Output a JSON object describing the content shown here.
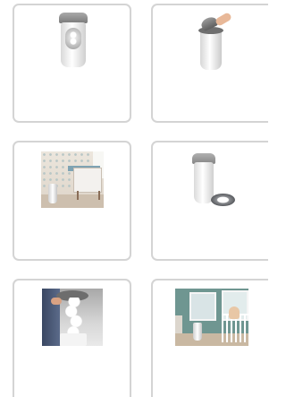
{
  "gallery": {
    "items": [
      {
        "icon": "nappy-bin-front-image"
      },
      {
        "icon": "nappy-bin-lid-open-image"
      },
      {
        "icon": "nursery-changing-table-image"
      },
      {
        "icon": "nappy-bin-with-refill-cassette-image"
      },
      {
        "icon": "nappy-chain-pull-image"
      },
      {
        "icon": "nursery-cot-room-image"
      }
    ]
  },
  "colors": {
    "card_border": "#d4d4d4",
    "background": "#ffffff"
  }
}
